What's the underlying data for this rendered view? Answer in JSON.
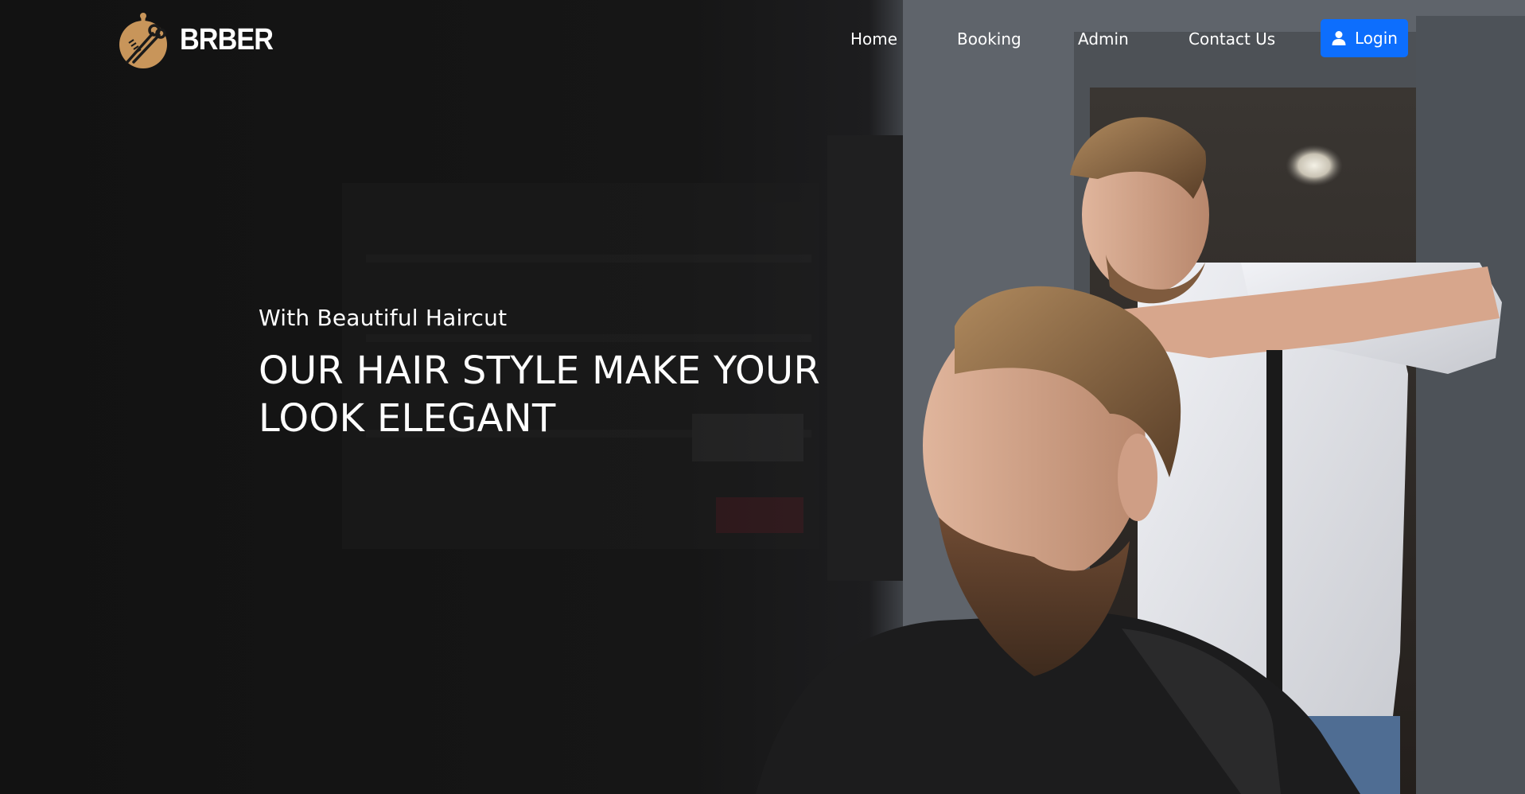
{
  "brand": {
    "name": "BRBER",
    "icon": "scissors-comb-icon",
    "icon_color": "#c8955a"
  },
  "nav": {
    "items": [
      {
        "label": "Home"
      },
      {
        "label": "Booking"
      },
      {
        "label": "Admin"
      },
      {
        "label": "Contact Us"
      }
    ],
    "login": {
      "label": "Login",
      "icon": "user-icon",
      "color": "#0d6efd"
    }
  },
  "hero": {
    "subtitle": "With Beautiful Haircut",
    "title": "OUR HAIR STYLE MAKE YOUR LOOK ELEGANT",
    "image": "barber-cutting-bearded-customer-hair-photo"
  }
}
